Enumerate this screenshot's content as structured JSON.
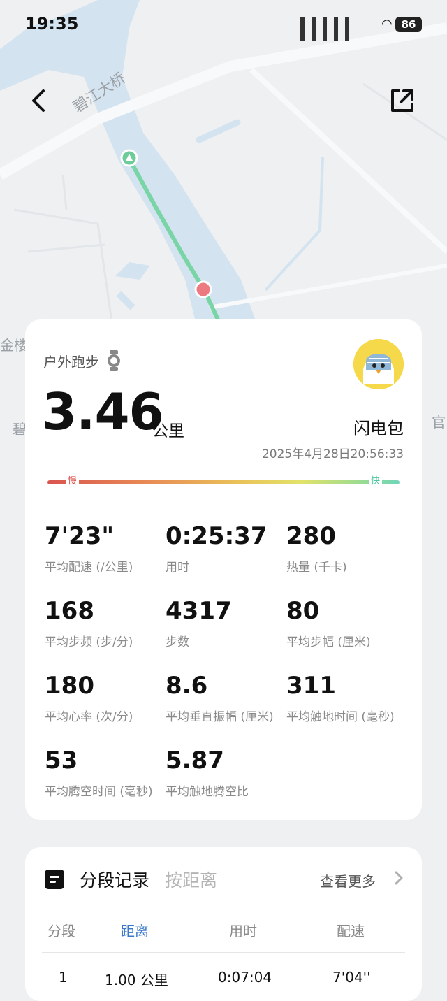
{
  "status_bar": {
    "time": "19:35",
    "battery": "86"
  },
  "map": {
    "labels": {
      "bridge": "碧江大桥",
      "jinlou": "金楼",
      "bi": "碧",
      "guan": "官"
    },
    "route_color": "#79d4a6",
    "start_marker_color": "#6ccc9a",
    "end_marker_color": "#ec7a80"
  },
  "summary": {
    "activity_type": "户外跑步",
    "distance": "3.46",
    "distance_unit": "公里",
    "nickname": "闪电包",
    "datetime": "2025年4月28日20:56:33",
    "pace_scale": {
      "slow": "慢",
      "fast": "快"
    },
    "stats": [
      {
        "value": "7'23\"",
        "label": "平均配速 (/公里)"
      },
      {
        "value": "0:25:37",
        "label": "用时"
      },
      {
        "value": "280",
        "label": "热量 (千卡)"
      },
      {
        "value": "168",
        "label": "平均步频 (步/分)"
      },
      {
        "value": "4317",
        "label": "步数"
      },
      {
        "value": "80",
        "label": "平均步幅 (厘米)"
      },
      {
        "value": "180",
        "label": "平均心率 (次/分)"
      },
      {
        "value": "8.6",
        "label": "平均垂直振幅 (厘米)"
      },
      {
        "value": "311",
        "label": "平均触地时间 (毫秒)"
      },
      {
        "value": "53",
        "label": "平均腾空时间 (毫秒)"
      },
      {
        "value": "5.87",
        "label": "平均触地腾空比"
      }
    ]
  },
  "segments": {
    "title": "分段记录",
    "mode": "按距离",
    "see_more": "查看更多",
    "columns": [
      "分段",
      "距离",
      "用时",
      "配速"
    ],
    "rows": [
      {
        "index": "1",
        "distance": "1.00 公里",
        "time": "0:07:04",
        "pace": "7'04''"
      }
    ]
  }
}
